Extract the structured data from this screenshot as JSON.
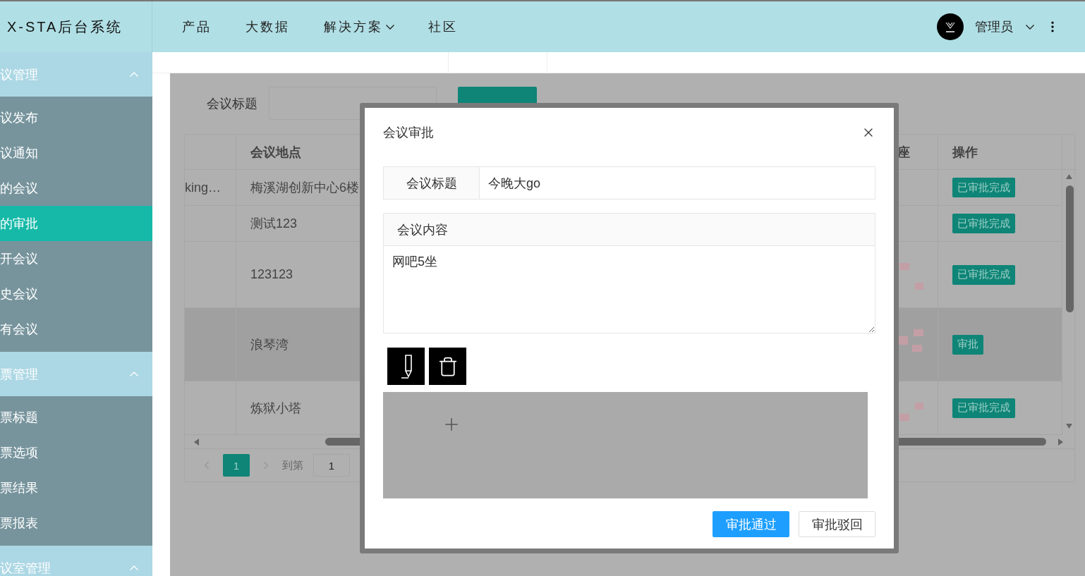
{
  "app_title": "X-STA后台系统",
  "nav": [
    {
      "label": "产品",
      "dropdown": false
    },
    {
      "label": "大数据",
      "dropdown": false
    },
    {
      "label": "解决方案",
      "dropdown": true
    },
    {
      "label": "社区",
      "dropdown": false
    }
  ],
  "user": {
    "name": "管理员"
  },
  "sidebar": [
    {
      "label": "议管理",
      "expanded": true,
      "children": [
        {
          "label": "议发布",
          "selected": false
        },
        {
          "label": "议通知",
          "selected": false
        },
        {
          "label": "的会议",
          "selected": false
        },
        {
          "label": "的审批",
          "selected": true
        },
        {
          "label": "开会议",
          "selected": false
        },
        {
          "label": "史会议",
          "selected": false
        },
        {
          "label": "有会议",
          "selected": false
        }
      ]
    },
    {
      "label": "票管理",
      "expanded": true,
      "children": [
        {
          "label": "票标题",
          "selected": false
        },
        {
          "label": "票选项",
          "selected": false
        },
        {
          "label": "票结果",
          "selected": false
        },
        {
          "label": "票报表",
          "selected": false
        }
      ]
    },
    {
      "label": "议室管理",
      "expanded": true
    }
  ],
  "filter": {
    "label": "会议标题"
  },
  "table": {
    "columns": [
      "会议地点",
      "座",
      "操作"
    ],
    "rows": [
      {
        "column_1": "king…",
        "location": "梅溪湖创新中心6楼",
        "seat_tags": false,
        "action": "已审批完成",
        "highlighted": false
      },
      {
        "location": "测试123",
        "seat_tags": false,
        "action": "已审批完成",
        "highlighted": false
      },
      {
        "location": "123123",
        "seat_tags": true,
        "action": "已审批完成",
        "highlighted": false
      },
      {
        "location": "浪琴湾",
        "seat_tags": true,
        "action": "审批",
        "highlighted": true
      },
      {
        "location": "炼狱小塔",
        "seat_tags": true,
        "action": "已审批完成",
        "highlighted": false
      }
    ]
  },
  "pagination": {
    "page": "1",
    "goto_label": "到第",
    "goto_value": "1"
  },
  "dialog": {
    "title": "会议审批",
    "fields": [
      {
        "label": "会议标题",
        "value": "今晚大go"
      }
    ],
    "content_label": "会议内容",
    "content_value": "网吧5坐",
    "buttons": [
      {
        "label": "审批通过",
        "primary": true
      },
      {
        "label": "审批驳回",
        "primary": false
      }
    ]
  }
}
